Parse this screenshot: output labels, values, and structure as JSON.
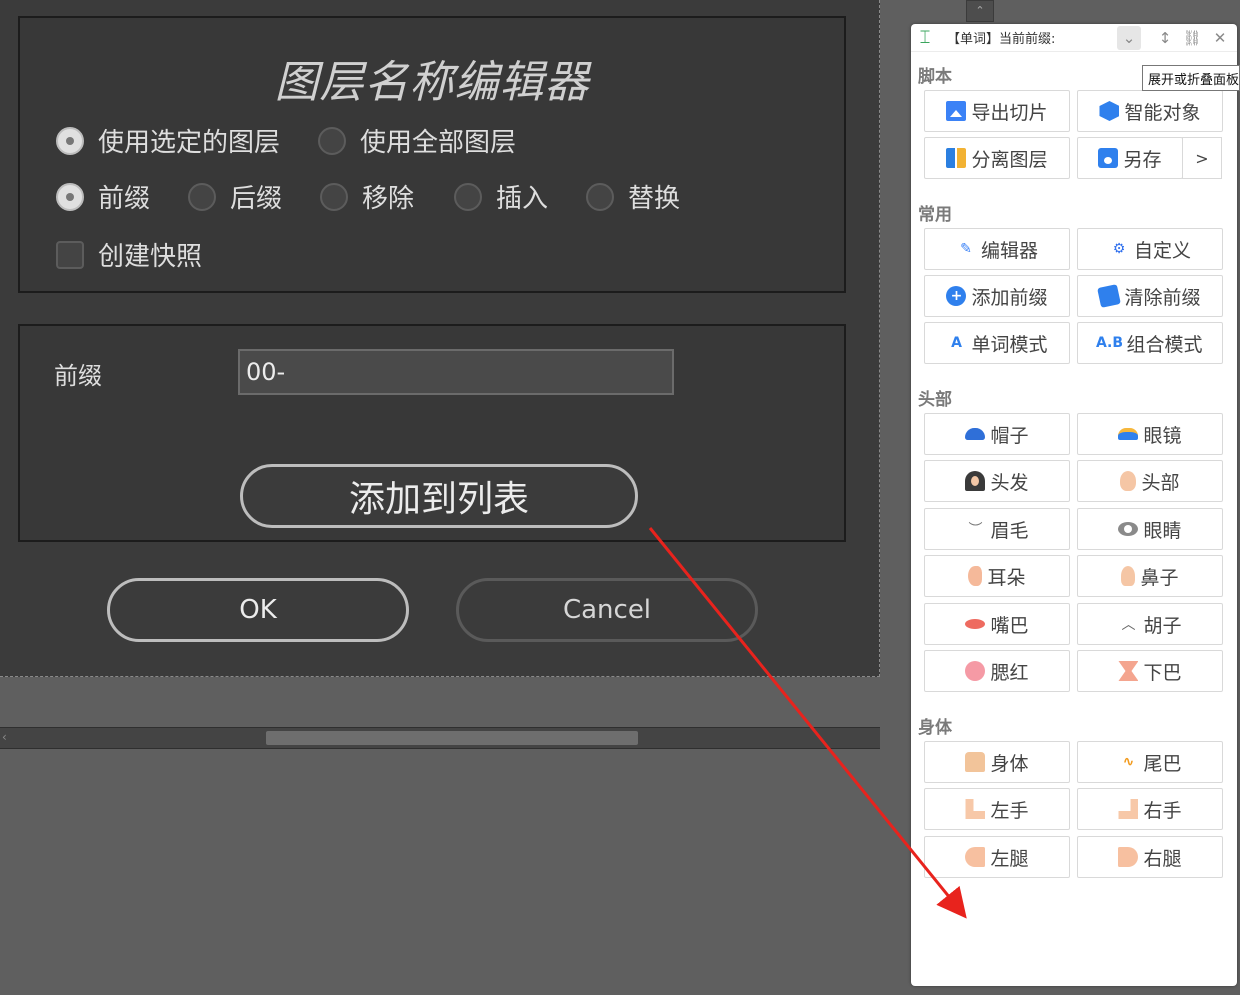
{
  "dialog": {
    "title": "图层名称编辑器",
    "layer_scope": [
      {
        "label": "使用选定的图层",
        "selected": true
      },
      {
        "label": "使用全部图层",
        "selected": false
      }
    ],
    "mode": [
      {
        "label": "前缀",
        "selected": true
      },
      {
        "label": "后缀",
        "selected": false
      },
      {
        "label": "移除",
        "selected": false
      },
      {
        "label": "插入",
        "selected": false
      },
      {
        "label": "替换",
        "selected": false
      }
    ],
    "snapshot_label": "创建快照",
    "snapshot_checked": false,
    "prefix_label": "前缀",
    "prefix_value": "00-",
    "add_button": "添加到列表",
    "ok_button": "OK",
    "cancel_button": "Cancel"
  },
  "side_panel": {
    "header_title": "【单词】当前前缀:",
    "tooltip": "展开或折叠面板",
    "sections": [
      {
        "title": "脚本",
        "buttons": [
          "导出切片",
          "智能对象",
          "分离图层",
          "另存"
        ],
        "more": ">"
      },
      {
        "title": "常用",
        "buttons": [
          "编辑器",
          "自定义",
          "添加前缀",
          "清除前缀",
          "单词模式",
          "组合模式"
        ]
      },
      {
        "title": "头部",
        "buttons": [
          "帽子",
          "眼镜",
          "头发",
          "头部",
          "眉毛",
          "眼睛",
          "耳朵",
          "鼻子",
          "嘴巴",
          "胡子",
          "腮红",
          "下巴"
        ]
      },
      {
        "title": "身体",
        "buttons": [
          "身体",
          "尾巴",
          "左手",
          "右手",
          "左腿",
          "右腿"
        ]
      }
    ]
  },
  "annotation_color": "#e8231d"
}
